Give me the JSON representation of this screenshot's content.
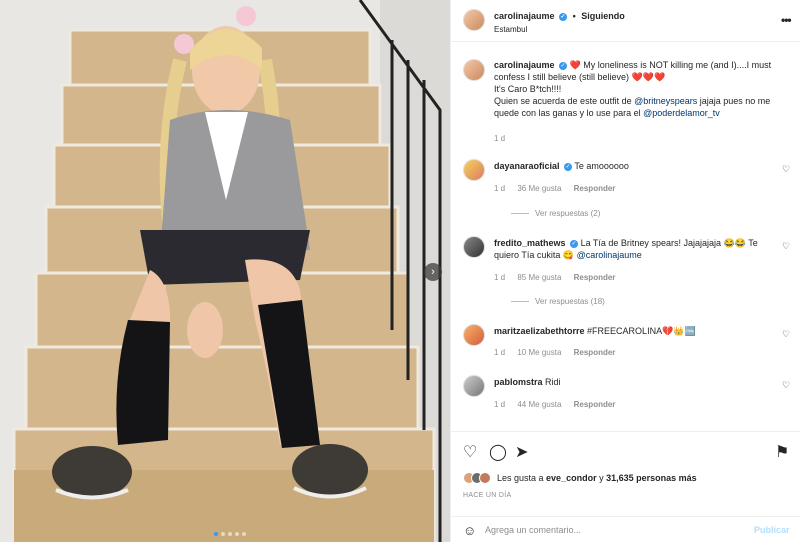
{
  "post_header": {
    "username": "carolinajaume",
    "separator": "•",
    "follow_label": "Siguiendo",
    "location": "Estambul"
  },
  "caption": {
    "username": "carolinajaume",
    "line1": "❤️ My loneliness is NOT killing me (and I)....I must confess I still believe (still believe) ❤️❤️❤️",
    "line2": "It's Caro B*tch!!!!",
    "line3_pre": "Quien se acuerda de este outfit de ",
    "mention1": "@britneyspears",
    "line3_mid": " jajaja pues no me quede con las ganas y lo use para el ",
    "mention2": "@poderdelamor_tv",
    "time": "1 d"
  },
  "comments": [
    {
      "username": "dayanaraoficial",
      "text": "Te amoooooo",
      "time": "1 d",
      "likes": "36 Me gusta",
      "reply_label": "Responder",
      "view_replies": "Ver respuestas (2)"
    },
    {
      "username": "fredito_mathews",
      "text": "La Tía de Britney spears! Jajajajaja 😂😂 Te quiero Tía cukita 😋 ",
      "mention": "@carolinajaume",
      "time": "1 d",
      "likes": "85 Me gusta",
      "reply_label": "Responder",
      "view_replies": "Ver respuestas (18)"
    },
    {
      "username": "maritzaelizabethtorre",
      "text": "#FREECAROLINA💔👑🆒",
      "time": "1 d",
      "likes": "10 Me gusta",
      "reply_label": "Responder"
    },
    {
      "username": "pablomstra",
      "text": "Ridi",
      "time": "1 d",
      "likes": "44 Me gusta",
      "reply_label": "Responder"
    }
  ],
  "actions": {
    "likes_prefix": "Les gusta a ",
    "likes_user": "eve_condor",
    "likes_mid": " y ",
    "likes_count": "31,635 personas más",
    "time_ago": "HACE UN DÍA"
  },
  "comment_box": {
    "placeholder": "Agrega un comentario...",
    "publish_label": "Publicar"
  },
  "icons": {
    "more": "more-dots-icon",
    "heart": "heart-icon",
    "comment": "comment-icon",
    "share": "share-icon",
    "save": "bookmark-icon",
    "emoji": "emoji-icon",
    "next": "chevron-right-icon"
  },
  "colors": {
    "verified": "#3897f0",
    "mention": "#00376b",
    "muted": "#8e8e8e",
    "publish_disabled": "#b2dffc"
  },
  "carousel": {
    "dots": 5,
    "active_index": 0
  }
}
